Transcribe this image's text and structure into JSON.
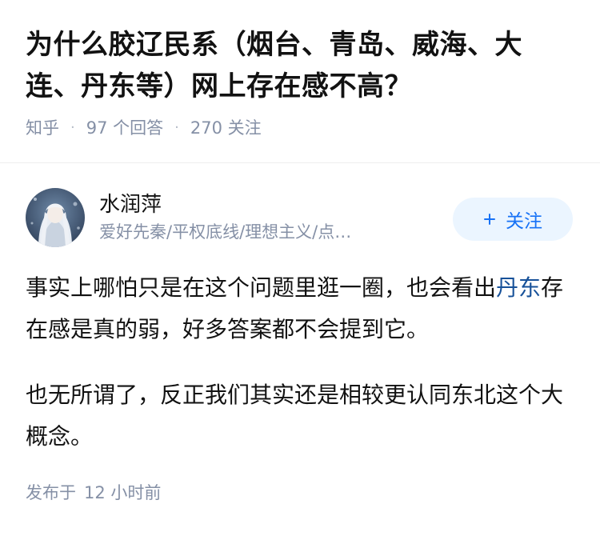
{
  "question": {
    "title": "为什么胶辽民系（烟台、青岛、威海、大连、丹东等）网上存在感不高？",
    "source": "知乎",
    "answer_count": "97 个回答",
    "follower_count": "270 关注"
  },
  "answer": {
    "author_name": "水润萍",
    "author_bio": "爱好先秦/平权底线/理想主义/点…",
    "follow_label": "关注",
    "paragraph1_before": "事实上哪怕只是在这个问题里逛一圈，也会看出",
    "paragraph1_link": "丹东",
    "paragraph1_after": "存在感是真的弱，好多答案都不会提到它。",
    "paragraph2": "也无所谓了，反正我们其实还是相较更认同东北这个大概念。",
    "publish_label": "发布于",
    "publish_time": "12 小时前"
  },
  "colors": {
    "link": "#175199",
    "accent": "#1772f6",
    "meta": "#8590a6",
    "follow_bg": "#ebf5ff"
  },
  "icons": {
    "follow": "plus-icon"
  }
}
